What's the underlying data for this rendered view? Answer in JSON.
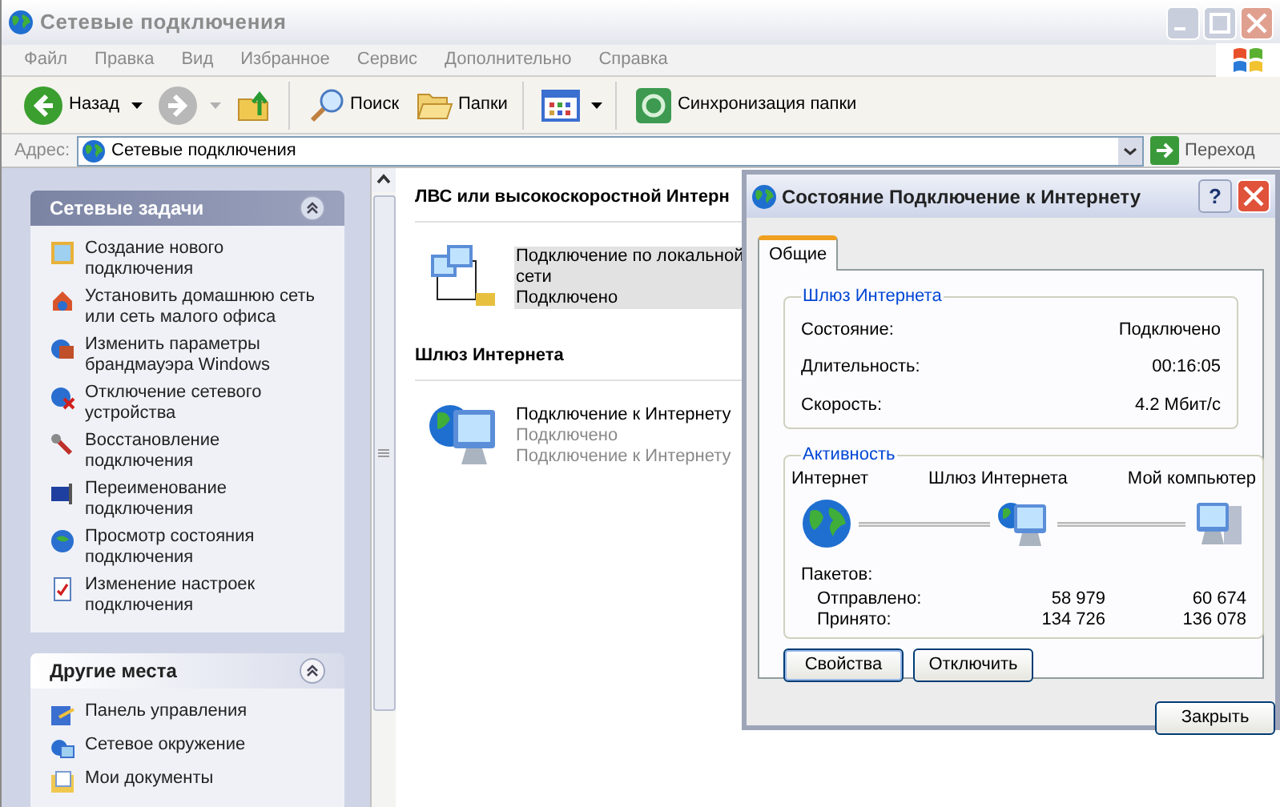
{
  "window": {
    "title": "Сетевые подключения",
    "active": false
  },
  "menu": [
    "Файл",
    "Правка",
    "Вид",
    "Избранное",
    "Сервис",
    "Дополнительно",
    "Справка"
  ],
  "toolbar": [
    {
      "kind": "back",
      "label": "Назад",
      "dropdown": true
    },
    {
      "kind": "forward",
      "dropdown": true
    },
    {
      "kind": "up"
    },
    {
      "kind": "search",
      "label": "Поиск"
    },
    {
      "kind": "folders",
      "label": "Папки"
    },
    {
      "kind": "views",
      "dropdown": true
    },
    {
      "kind": "sync",
      "label": "Синхронизация папки"
    }
  ],
  "address": {
    "label": "Адрес:",
    "value": "Сетевые подключения",
    "go": "Переход"
  },
  "task_panels": [
    {
      "kind": "special",
      "title": "Сетевые задачи",
      "items": [
        {
          "kind": "wizard",
          "text": "Создание нового подключения"
        },
        {
          "kind": "home",
          "text": "Установить домашнюю сеть или сеть малого офиса"
        },
        {
          "kind": "firewall",
          "text": "Изменить параметры брандмауэра Windows"
        },
        {
          "kind": "disable",
          "text": "Отключение сетевого устройства"
        },
        {
          "kind": "repair",
          "text": "Восстановление подключения"
        },
        {
          "kind": "rename",
          "text": "Переименование подключения"
        },
        {
          "kind": "status",
          "text": "Просмотр состояния подключения"
        },
        {
          "kind": "settings",
          "text": "Изменение настроек подключения"
        }
      ]
    },
    {
      "kind": "normal",
      "title": "Другие места",
      "items": [
        {
          "kind": "control",
          "text": "Панель управления"
        },
        {
          "kind": "network",
          "text": "Сетевое окружение"
        },
        {
          "kind": "docs",
          "text": "Мои документы"
        }
      ]
    }
  ],
  "groups": [
    {
      "title": "ЛВС или высокоскоростной Интерн",
      "items": [
        {
          "kind": "lan",
          "name": "Подключение по локальной сети",
          "lines": [
            "Подключено"
          ],
          "selected": true
        }
      ]
    },
    {
      "title": "Шлюз Интернета",
      "items": [
        {
          "kind": "gateway",
          "name": "Подключение к Интернету",
          "lines": [
            "Подключено",
            "Подключение к Интернету"
          ],
          "selected": false
        }
      ]
    }
  ],
  "dialog": {
    "title": "Состояние Подключение к Интернету",
    "help": "?",
    "tabs": [
      {
        "label": "Общие",
        "selected": true
      }
    ],
    "gateway_group": {
      "title": "Шлюз Интернета",
      "rows": [
        {
          "label": "Состояние:",
          "value": "Подключено"
        },
        {
          "label": "Длительность:",
          "value": "00:16:05"
        },
        {
          "label": "Скорость:",
          "value": "4.2 Мбит/с"
        }
      ]
    },
    "activity_group": {
      "title": "Активность",
      "nodes": [
        {
          "kind": "globe",
          "label": "Интернет"
        },
        {
          "kind": "gateway",
          "label": "Шлюз Интернета"
        },
        {
          "kind": "computer",
          "label": "Мой компьютер"
        }
      ],
      "packets_label": "Пакетов:",
      "packet_rows": [
        {
          "label": "Отправлено:",
          "values": [
            "58 979",
            "60 674"
          ]
        },
        {
          "label": "Принято:",
          "values": [
            "134 726",
            "136 078"
          ]
        }
      ]
    },
    "buttons": [
      "Свойства",
      "Отключить"
    ],
    "close_button": "Закрыть"
  }
}
